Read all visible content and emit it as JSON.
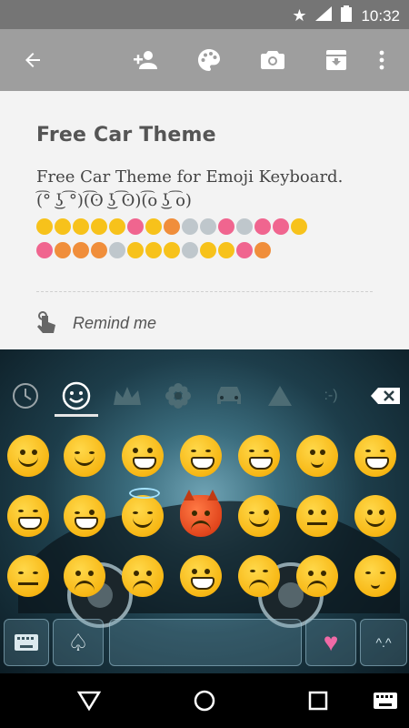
{
  "status_bar": {
    "time": "10:32"
  },
  "note": {
    "title": "Free Car Theme",
    "description_line1": "Free Car Theme for Emoji Keyboard.",
    "description_line2": "(͡° ͜ʖ ͡°)(͡ʘ ͜ʖ ͡ʘ)(͡o ͜ʖ ͡o)",
    "remind_label": "Remind me"
  },
  "keyboard": {
    "tabs": [
      "recent",
      "smileys",
      "crown",
      "flower",
      "car",
      "triangle",
      "emoticons"
    ],
    "active_tab": "smileys",
    "emoticon_tab_label": ":-)",
    "space_key": "space"
  },
  "colors": {
    "status_bar": "#757575",
    "app_bar": "#9e9e9e",
    "background": "#f3f3f3",
    "emoji_yellow": "#f7c21b"
  }
}
